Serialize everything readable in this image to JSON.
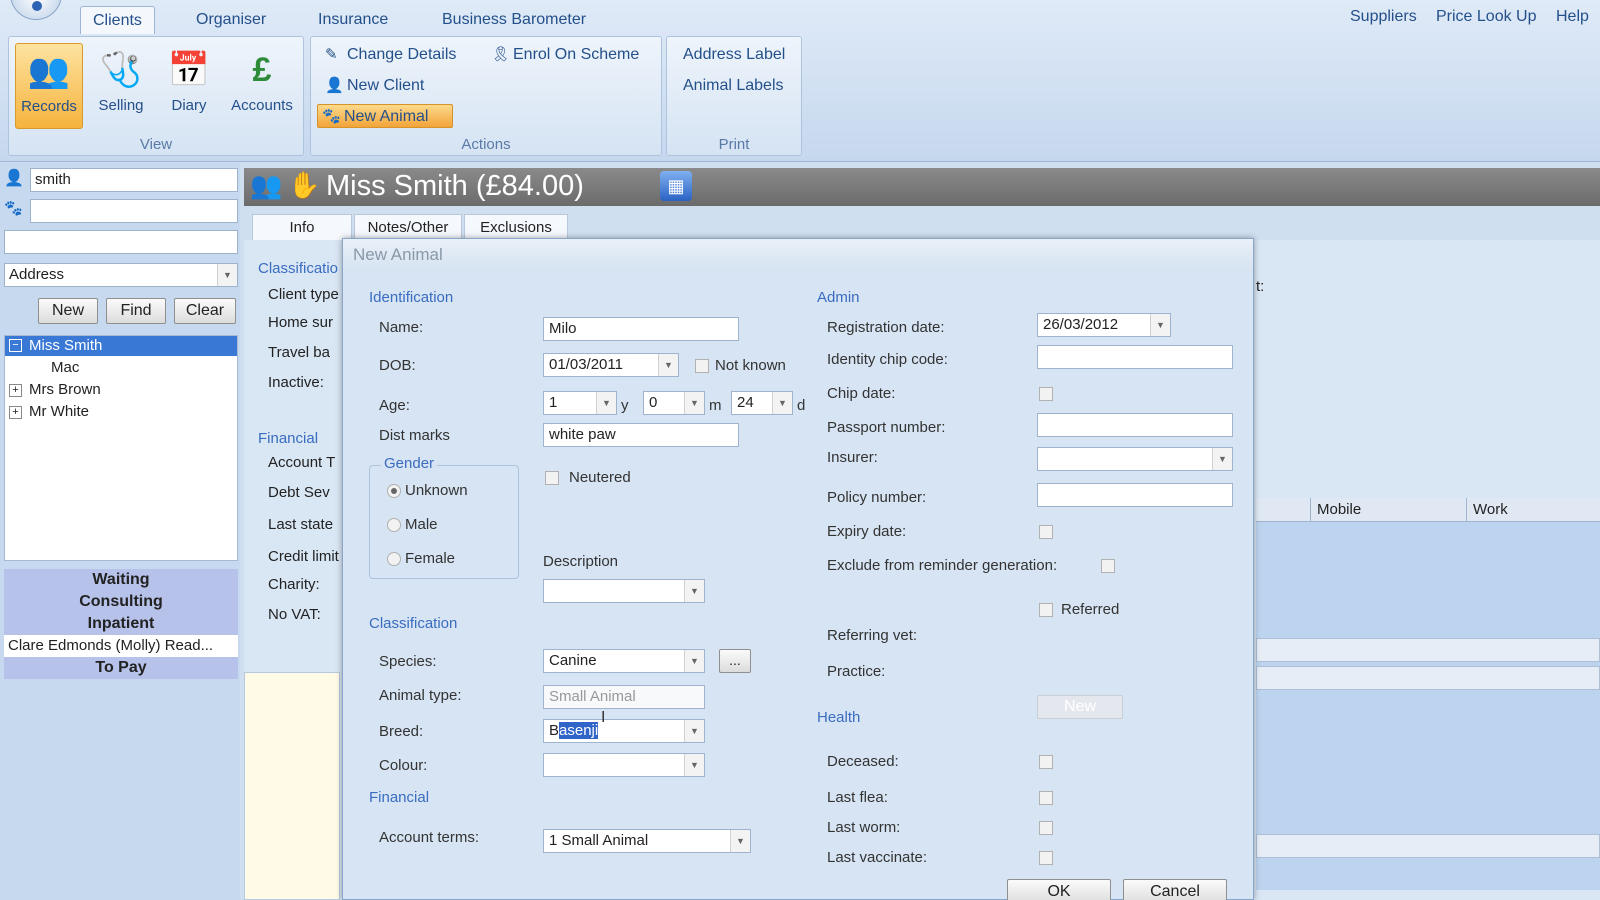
{
  "ribbon": {
    "tabs": [
      "Clients",
      "Organiser",
      "Insurance",
      "Business Barometer"
    ],
    "top_links": [
      "Suppliers",
      "Price Look Up",
      "Help"
    ],
    "view_buttons": [
      "Records",
      "Selling",
      "Diary",
      "Accounts"
    ],
    "view_label": "View",
    "actions": {
      "change_details": "Change Details",
      "enrol": "Enrol On Scheme",
      "new_client": "New Client",
      "new_animal": "New Animal"
    },
    "actions_label": "Actions",
    "print": {
      "address_label": "Address Label",
      "animal_labels": "Animal Labels"
    },
    "print_label": "Print"
  },
  "left": {
    "client_search": "smith",
    "animal_search": "",
    "extra_search": "",
    "search_type": "Address",
    "buttons": {
      "new": "New",
      "find": "Find",
      "clear": "Clear"
    },
    "tree": {
      "root": "Miss Smith",
      "child": "Mac",
      "other1": "Mrs Brown",
      "other2": "Mr White"
    },
    "queue": {
      "waiting": "Waiting",
      "consulting": "Consulting",
      "inpatient": "Inpatient",
      "item": "Clare Edmonds (Molly) Read...",
      "topay": "To Pay"
    }
  },
  "main": {
    "title": "Miss Smith (£84.00)",
    "tabs": [
      "Info",
      "Notes/Other",
      "Exclusions"
    ],
    "classification": "Classificatio",
    "rows": [
      "Client type",
      "Home sur",
      "Travel ba",
      "Inactive:"
    ],
    "financial": "Financial",
    "fin_rows": [
      "Account T",
      "Debt Sev",
      "Last state",
      "Credit limit",
      "Charity:",
      "No VAT:"
    ],
    "right_fragment": "t:",
    "columns": {
      "mobile": "Mobile",
      "work": "Work"
    }
  },
  "dialog": {
    "title": "New Animal",
    "identification": "Identification",
    "name_label": "Name:",
    "name": "Milo",
    "dob_label": "DOB:",
    "dob": "01/03/2011",
    "not_known": "Not known",
    "age_label": "Age:",
    "age_y": "1",
    "age_m": "0",
    "age_d": "24",
    "unit_y": "y",
    "unit_m": "m",
    "unit_d": "d",
    "dist_label": "Dist marks",
    "dist": "white paw",
    "gender": "Gender",
    "unknown": "Unknown",
    "male": "Male",
    "female": "Female",
    "neutered": "Neutered",
    "description": "Description",
    "classification": "Classification",
    "species_label": "Species:",
    "species": "Canine",
    "more": "...",
    "animal_type_label": "Animal type:",
    "animal_type": "Small Animal",
    "breed_label": "Breed:",
    "breed_first": "B",
    "breed_sel": "asenji",
    "colour_label": "Colour:",
    "financial": "Financial",
    "account_terms_label": "Account terms:",
    "account_terms": "1 Small Animal",
    "admin": "Admin",
    "reg_label": "Registration date:",
    "reg_date": "26/03/2012",
    "chip_label": "Identity chip code:",
    "chip_date": "Chip date:",
    "passport": "Passport number:",
    "insurer": "Insurer:",
    "policy": "Policy number:",
    "expiry": "Expiry date:",
    "exclude": "Exclude from reminder generation:",
    "referred": "Referred",
    "referring_vet": "Referring vet:",
    "practice": "Practice:",
    "new_btn": "New",
    "health": "Health",
    "deceased": "Deceased:",
    "last_flea": "Last flea:",
    "last_worm": "Last worm:",
    "last_vacc": "Last vaccinate:",
    "ok": "OK",
    "cancel": "Cancel"
  }
}
